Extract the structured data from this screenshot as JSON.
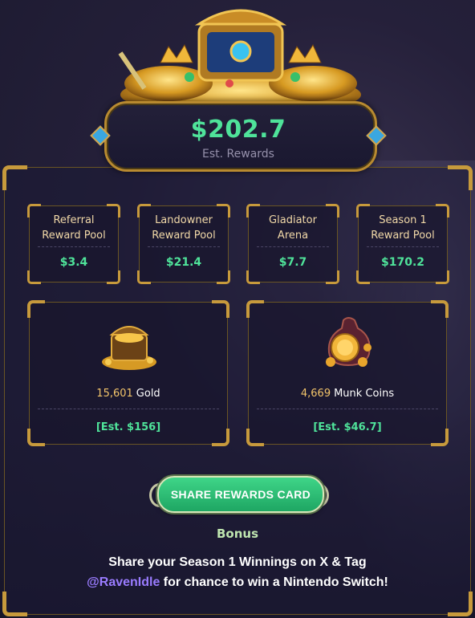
{
  "header": {
    "total_value": "$202.7",
    "total_label": "Est. Rewards"
  },
  "pools": [
    {
      "title_line1": "Referral",
      "title_line2": "Reward Pool",
      "value": "$3.4"
    },
    {
      "title_line1": "Landowner",
      "title_line2": "Reward Pool",
      "value": "$21.4"
    },
    {
      "title_line1": "Gladiator",
      "title_line2": "Arena",
      "value": "$7.7"
    },
    {
      "title_line1": "Season 1",
      "title_line2": "Reward Pool",
      "value": "$170.2"
    }
  ],
  "resources": [
    {
      "icon": "treasure-chest-icon",
      "amount": "15,601",
      "unit": "Gold",
      "estimate": "[Est. $156]"
    },
    {
      "icon": "coin-bag-icon",
      "amount": "4,669",
      "unit": "Munk Coins",
      "estimate": "[Est. $46.7]"
    }
  ],
  "share": {
    "button_label": "SHARE REWARDS CARD",
    "bonus_label": "Bonus",
    "promo_line1": "Share your Season 1 Winnings on X & Tag",
    "promo_handle": "@RavenIdle",
    "promo_line2_rest": " for chance to win a Nintendo Switch!"
  },
  "colors": {
    "accent_green": "#4fe39a",
    "gold_border": "#c79a3c",
    "handle_purple": "#9a7cff"
  }
}
